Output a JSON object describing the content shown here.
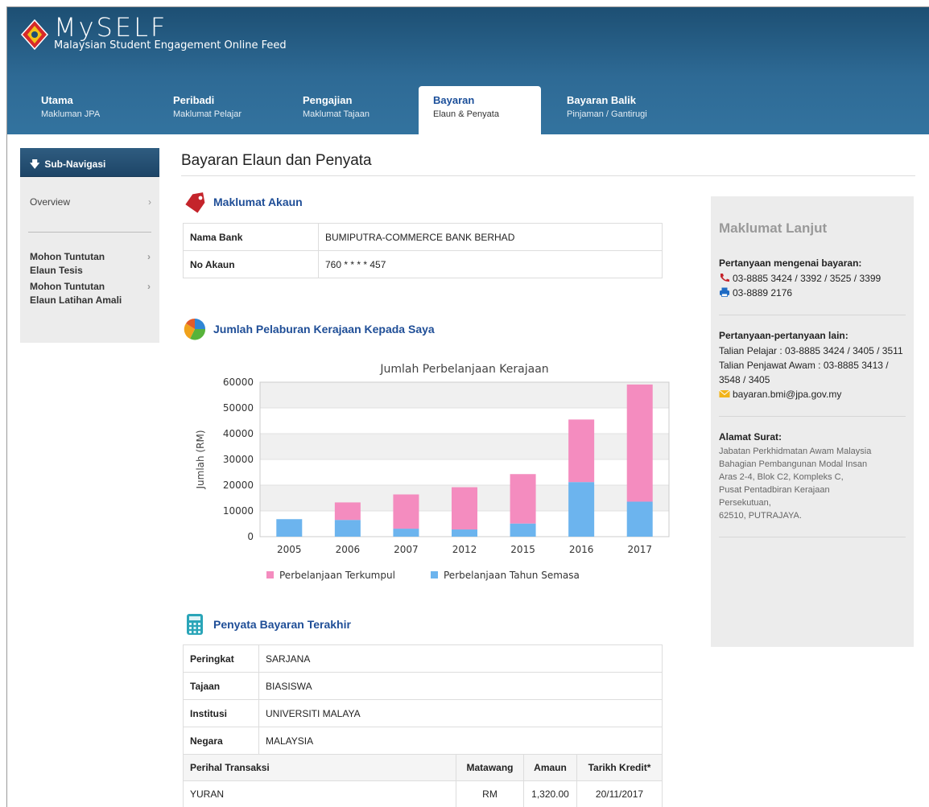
{
  "header": {
    "logo_title": "MySELF",
    "logo_subtitle": "Malaysian Student Engagement Online Feed",
    "tabs": [
      {
        "label": "Utama",
        "sublabel": "Makluman JPA"
      },
      {
        "label": "Peribadi",
        "sublabel": "Maklumat Pelajar"
      },
      {
        "label": "Pengajian",
        "sublabel": "Maklumat Tajaan"
      },
      {
        "label": "Bayaran",
        "sublabel": "Elaun & Penyata"
      },
      {
        "label": "Bayaran Balik",
        "sublabel": "Pinjaman / Gantirugi"
      }
    ],
    "active_tab": "Bayaran"
  },
  "sidebar": {
    "title": "Sub-Navigasi",
    "items": [
      {
        "label": "Overview"
      },
      {
        "label": "Mohon Tuntutan Elaun Tesis"
      },
      {
        "label": "Mohon Tuntutan Elaun Latihan Amali"
      }
    ]
  },
  "main": {
    "page_title": "Bayaran Elaun dan Penyata",
    "account": {
      "heading": "Maklumat Akaun",
      "rows": [
        {
          "label": "Nama Bank",
          "value": "BUMIPUTRA-COMMERCE BANK BERHAD"
        },
        {
          "label": "No Akaun",
          "value": "760 * * * * 457"
        }
      ]
    },
    "investment": {
      "heading": "Jumlah Pelaburan Kerajaan Kepada Saya"
    },
    "statement": {
      "heading": "Penyata Bayaran Terakhir",
      "rows": [
        {
          "label": "Peringkat",
          "value": "SARJANA"
        },
        {
          "label": "Tajaan",
          "value": "BIASISWA"
        },
        {
          "label": "Institusi",
          "value": "UNIVERSITI MALAYA"
        },
        {
          "label": "Negara",
          "value": "MALAYSIA"
        }
      ],
      "columns": [
        "Perihal Transaksi",
        "Matawang",
        "Amaun",
        "Tarikh Kredit*"
      ],
      "transactions": [
        {
          "desc": "YURAN",
          "currency": "RM",
          "amount": "1,320.00",
          "date": "20/11/2017"
        }
      ]
    }
  },
  "panel": {
    "title": "Maklumat Lanjut",
    "payment_heading": "Pertanyaan mengenai bayaran:",
    "payment_phone": "03-8885 3424 / 3392 / 3525 / 3399",
    "payment_fax": "03-8889 2176",
    "other_heading": "Pertanyaan-pertanyaan lain:",
    "other_line1": "Talian Pelajar : 03-8885 3424 / 3405 / 3511",
    "other_line2": "Talian Penjawat Awam : 03-8885 3413 / 3548 / 3405",
    "other_email": "bayaran.bmi@jpa.gov.my",
    "address_heading": "Alamat Surat:",
    "address_lines": [
      "Jabatan Perkhidmatan Awam Malaysia",
      "Bahagian Pembangunan Modal Insan",
      "Aras 2-4, Blok C2, Kompleks C,",
      "Pusat Pentadbiran Kerajaan",
      "Persekutuan,",
      "62510, PUTRAJAYA."
    ]
  },
  "colors": {
    "accumulated": "#f48cbf",
    "current_year": "#6cb4ee",
    "header_dark": "#1d4f73",
    "link_blue": "#1f4e97"
  },
  "chart_data": {
    "type": "bar",
    "stacked": true,
    "title": "Jumlah Perbelanjaan Kerajaan",
    "xlabel": "",
    "ylabel": "Jumlah (RM)",
    "ylim": [
      0,
      60000
    ],
    "yticks": [
      0,
      10000,
      20000,
      30000,
      40000,
      50000,
      60000
    ],
    "categories": [
      "2005",
      "2006",
      "2007",
      "2012",
      "2015",
      "2016",
      "2017"
    ],
    "series": [
      {
        "name": "Perbelanjaan Tahun Semasa",
        "color": "#6cb4ee",
        "values": [
          6800,
          6500,
          3100,
          2800,
          5100,
          21200,
          13600
        ]
      },
      {
        "name": "Perbelanjaan Terkumpul",
        "color": "#f48cbf",
        "values": [
          0,
          6800,
          13300,
          16400,
          19200,
          24300,
          45500
        ]
      }
    ],
    "legend": {
      "placement": "bottom",
      "order": [
        "Perbelanjaan Terkumpul",
        "Perbelanjaan Tahun Semasa"
      ]
    },
    "grid": true
  }
}
